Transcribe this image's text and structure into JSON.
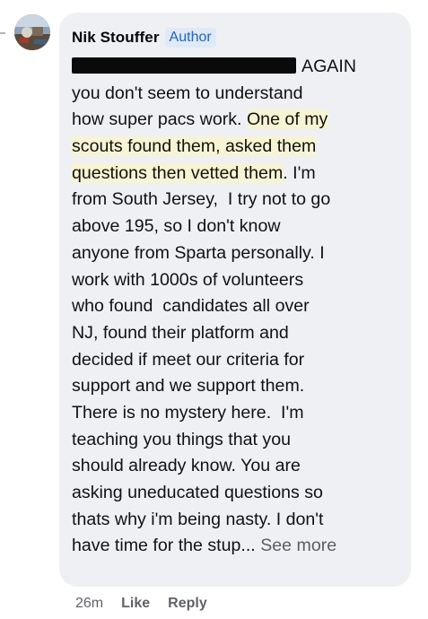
{
  "comment": {
    "author_name": "Nik Stouffer",
    "author_badge": "Author",
    "lines": [
      {
        "text": "AGAIN",
        "redacted_prefix": true
      },
      {
        "text": "you don't seem to understand"
      },
      {
        "pre": "how super pacs work. ",
        "hl": "One of my"
      },
      {
        "hl": "scouts found them, asked them"
      },
      {
        "hl": "questions then vetted them",
        "post": ". I'm"
      },
      {
        "text": "from South Jersey,  I try not to go"
      },
      {
        "text": "above 195, so I don't know"
      },
      {
        "text": "anyone from Sparta personally. I"
      },
      {
        "text": "work with 1000s of volunteers"
      },
      {
        "text": "who found  candidates all over"
      },
      {
        "text": "NJ, found their platform and"
      },
      {
        "text": "decided if meet our criteria for"
      },
      {
        "text": "support and we support them."
      },
      {
        "text": "There is no mystery here.  I'm"
      },
      {
        "text": "teaching you things that you"
      },
      {
        "text": "should already know. You are"
      },
      {
        "text": "asking uneducated questions so"
      },
      {
        "text": "thats why i'm being nasty. I don't"
      },
      {
        "text": "have time for the stup...",
        "see_more": "See more"
      }
    ],
    "timestamp": "26m",
    "like_label": "Like",
    "reply_label": "Reply"
  },
  "colors": {
    "bubble_bg": "#eef0f3",
    "author_badge_text": "#1b65d8",
    "highlight": "#faf6c8"
  },
  "icons": {
    "avatar": "profile-photo"
  }
}
